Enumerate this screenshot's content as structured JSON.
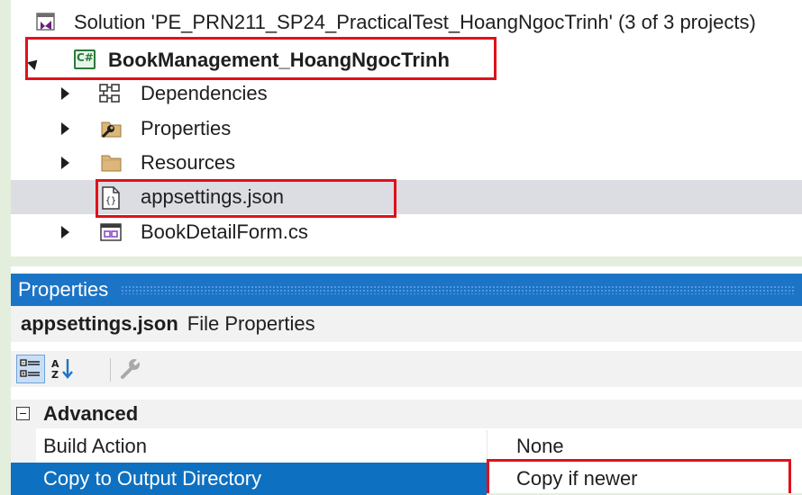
{
  "solution_explorer": {
    "solution_label": "Solution 'PE_PRN211_SP24_PracticalTest_HoangNgocTrinh' (3 of 3 projects)",
    "project": {
      "label": "BookManagement_HoangNgocTrinh",
      "icon": "csharp-project-icon",
      "icon_text": "C#",
      "expanded": true
    },
    "items": [
      {
        "label": "Dependencies",
        "icon": "dependencies-icon",
        "expandable": true
      },
      {
        "label": "Properties",
        "icon": "properties-folder-icon",
        "expandable": true
      },
      {
        "label": "Resources",
        "icon": "folder-icon",
        "expandable": true
      },
      {
        "label": "appsettings.json",
        "icon": "json-file-icon",
        "expandable": false,
        "selected": true
      },
      {
        "label": "BookDetailForm.cs",
        "icon": "form-file-icon",
        "expandable": true
      }
    ]
  },
  "properties_panel": {
    "title": "Properties",
    "object_name": "appsettings.json",
    "object_kind": "File Properties",
    "toolbar": [
      "categorized-icon",
      "alphabetical-icon",
      "property-pages-icon"
    ],
    "category": "Advanced",
    "rows": [
      {
        "name": "Build Action",
        "value": "None",
        "selected": false
      },
      {
        "name": "Copy to Output Directory",
        "value": "Copy if newer",
        "selected": true
      }
    ]
  },
  "colors": {
    "highlight_red": "#e0111b",
    "title_blue": "#1c74c6",
    "selection_blue": "#0e70c0",
    "tree_selection": "#dcdde3",
    "page_background": "#e4eedc"
  }
}
